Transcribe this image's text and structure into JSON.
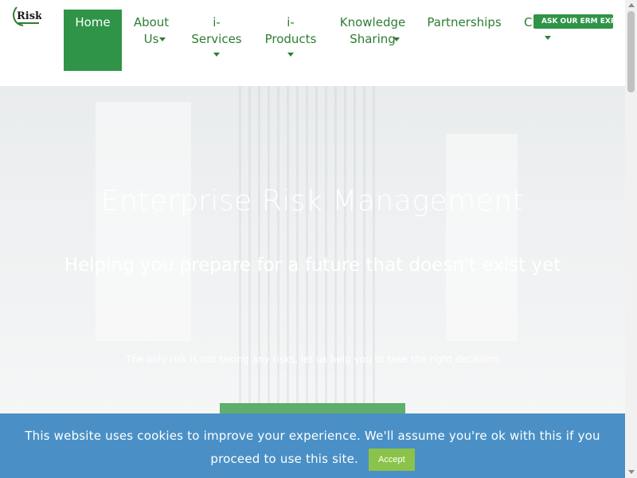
{
  "header": {
    "logo_text": "Risk",
    "nav": [
      {
        "label": "Home"
      },
      {
        "label": "About\nUs"
      },
      {
        "label": "i-\nServices"
      },
      {
        "label": "i-\nProducts"
      },
      {
        "label": "Knowledge\nSharing"
      },
      {
        "label": "Partnerships"
      },
      {
        "label": "C"
      }
    ],
    "ask_button": "ASK OUR ERM EXPE"
  },
  "hero": {
    "title": "Enterprise Risk Management",
    "subtitle": "Helping you prepare for a future that doesn't exist yet",
    "tagline": "The only risk is not taking any risks, let us help you to take the right decisions",
    "cta": ""
  },
  "cookie": {
    "text": "This website uses cookies to improve your experience. We'll assume you're ok with this if you proceed to use this site.",
    "accept": "Accept"
  },
  "colors": {
    "brand_green": "#2f9447",
    "cookie_bg": "#4a90c6",
    "accept_green": "#8bc34a"
  }
}
